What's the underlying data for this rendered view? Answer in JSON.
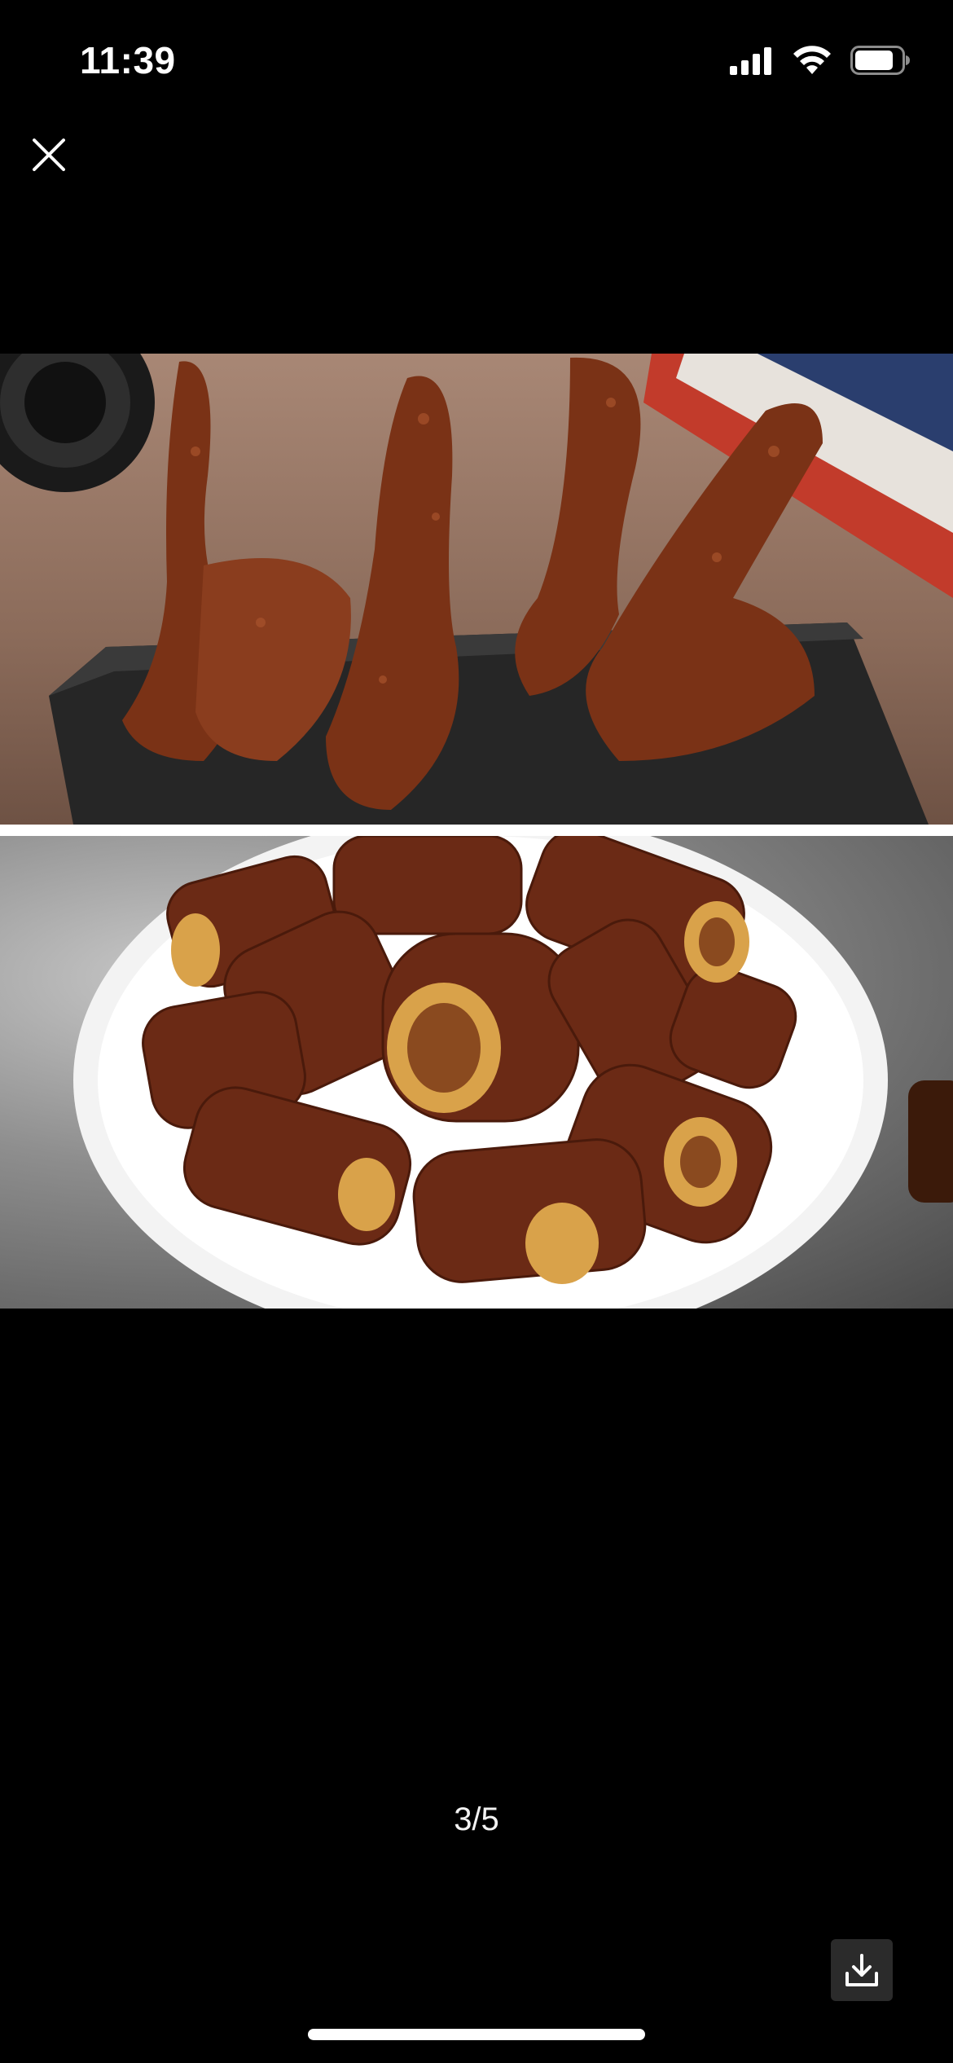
{
  "status_bar": {
    "time": "11:39",
    "icons": [
      "cellular-signal-icon",
      "wifi-icon",
      "battery-icon"
    ]
  },
  "viewer": {
    "close_icon": "close-icon",
    "images": [
      {
        "name": "braised-duck-tongues-photo"
      },
      {
        "name": "braised-intestine-plate-photo"
      }
    ],
    "counter": "3/5",
    "download_icon": "download-icon"
  },
  "colors": {
    "background": "#000000",
    "text": "#ffffff",
    "download_button_bg": "#2b2b2b"
  }
}
